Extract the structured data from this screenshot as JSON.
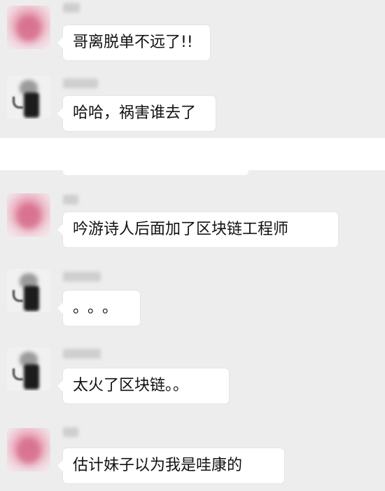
{
  "chat": {
    "messages": [
      {
        "avatar": "pink-character-avatar",
        "sender_visible": false,
        "text": "哥离脱单不远了!!"
      },
      {
        "avatar": "dark-character-avatar",
        "sender_visible": false,
        "text": "哈哈，祸害谁去了"
      },
      {
        "avatar": "pink-character-avatar",
        "sender_visible": false,
        "text": "吟游诗人后面加了区块链工程师"
      },
      {
        "avatar": "dark-character-avatar",
        "sender_visible": false,
        "text": "。。。"
      },
      {
        "avatar": "dark-character-avatar",
        "sender_visible": false,
        "text": "太火了区块链。。"
      },
      {
        "avatar": "pink-character-avatar",
        "sender_visible": false,
        "text": "估计妹子以为我是哇康的"
      }
    ]
  },
  "colors": {
    "background": "#ededed",
    "bubble": "#ffffff",
    "text": "#111111"
  }
}
